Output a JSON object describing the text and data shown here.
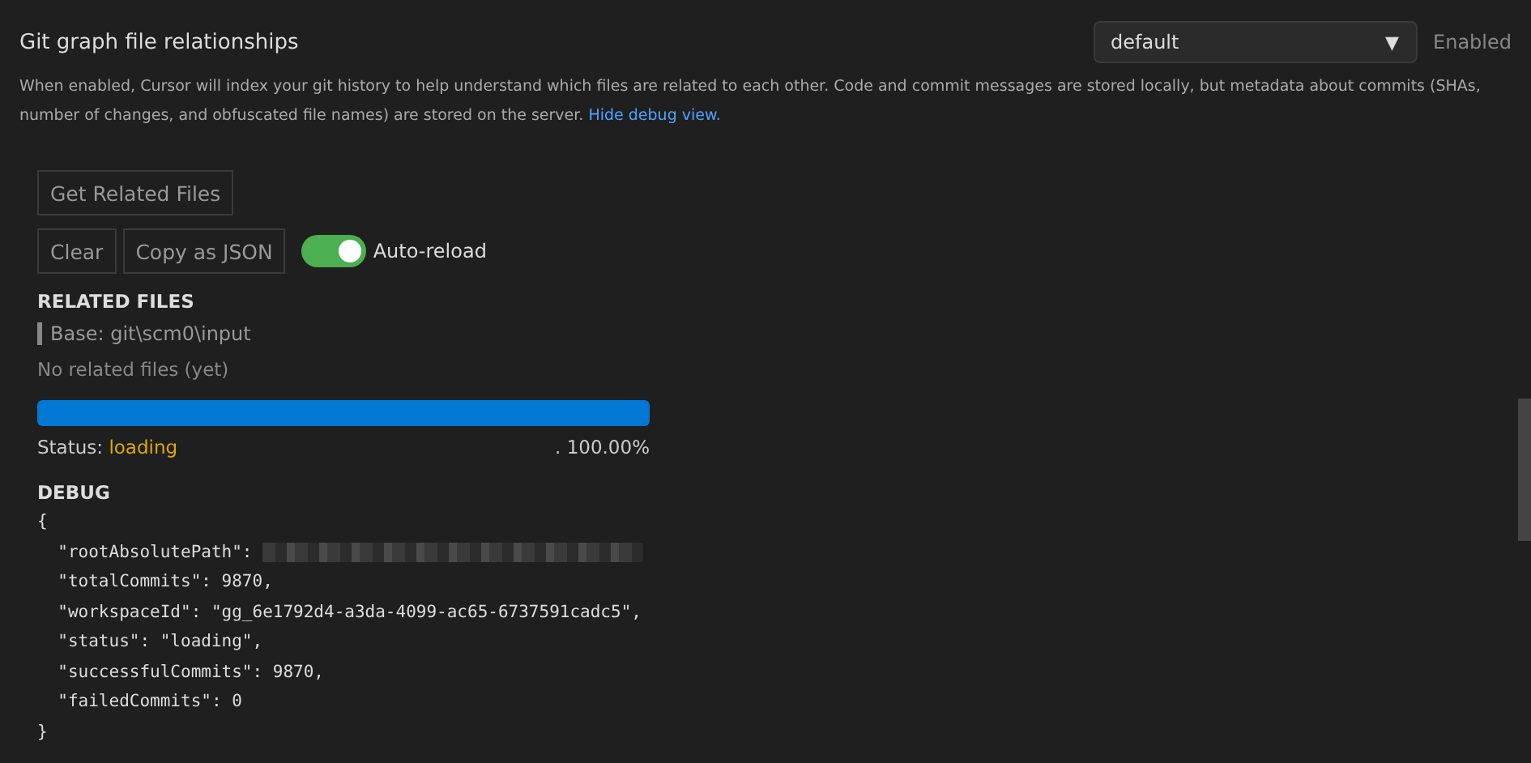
{
  "setting": {
    "title": "Git graph file relationships",
    "dropdown": {
      "value": "default",
      "caret": "▼"
    },
    "state_label": "Enabled",
    "description": "When enabled, Cursor will index your git history to help understand which files are related to each other. Code and commit messages are stored locally, but metadata about commits (SHAs, number of changes, and obfuscated file names) are stored on the server.",
    "link": "Hide debug view."
  },
  "buttons_row1": [
    "Get Related Files"
  ],
  "buttons_row2": [
    "Clear",
    "Copy as JSON"
  ],
  "toggle": {
    "label": "Auto-reload",
    "on": true
  },
  "related": {
    "heading": "RELATED FILES",
    "base": "Base: git\\scm0\\input",
    "empty": "No related files (yet)"
  },
  "progress": {
    "level": 1.0,
    "status_label": "Status:",
    "status_value": "loading",
    "reading": ". 100.00%"
  },
  "debug": {
    "heading": "DEBUG",
    "lines": [
      {
        "text": "{",
        "redacted": false
      },
      {
        "text": "  \"rootAbsolutePath\": ",
        "redacted": true
      },
      {
        "text": "  \"totalCommits\": 9870,",
        "redacted": false
      },
      {
        "text": "  \"workspaceId\": \"gg_6e1792d4-a3da-4099-ac65-6737591cadc5\",",
        "redacted": false
      },
      {
        "text": "  \"status\": \"loading\",",
        "redacted": false
      },
      {
        "text": "  \"successfulCommits\": 9870,",
        "redacted": false
      },
      {
        "text": "  \"failedCommits\": 0",
        "redacted": false
      },
      {
        "text": "}",
        "redacted": false
      }
    ]
  }
}
